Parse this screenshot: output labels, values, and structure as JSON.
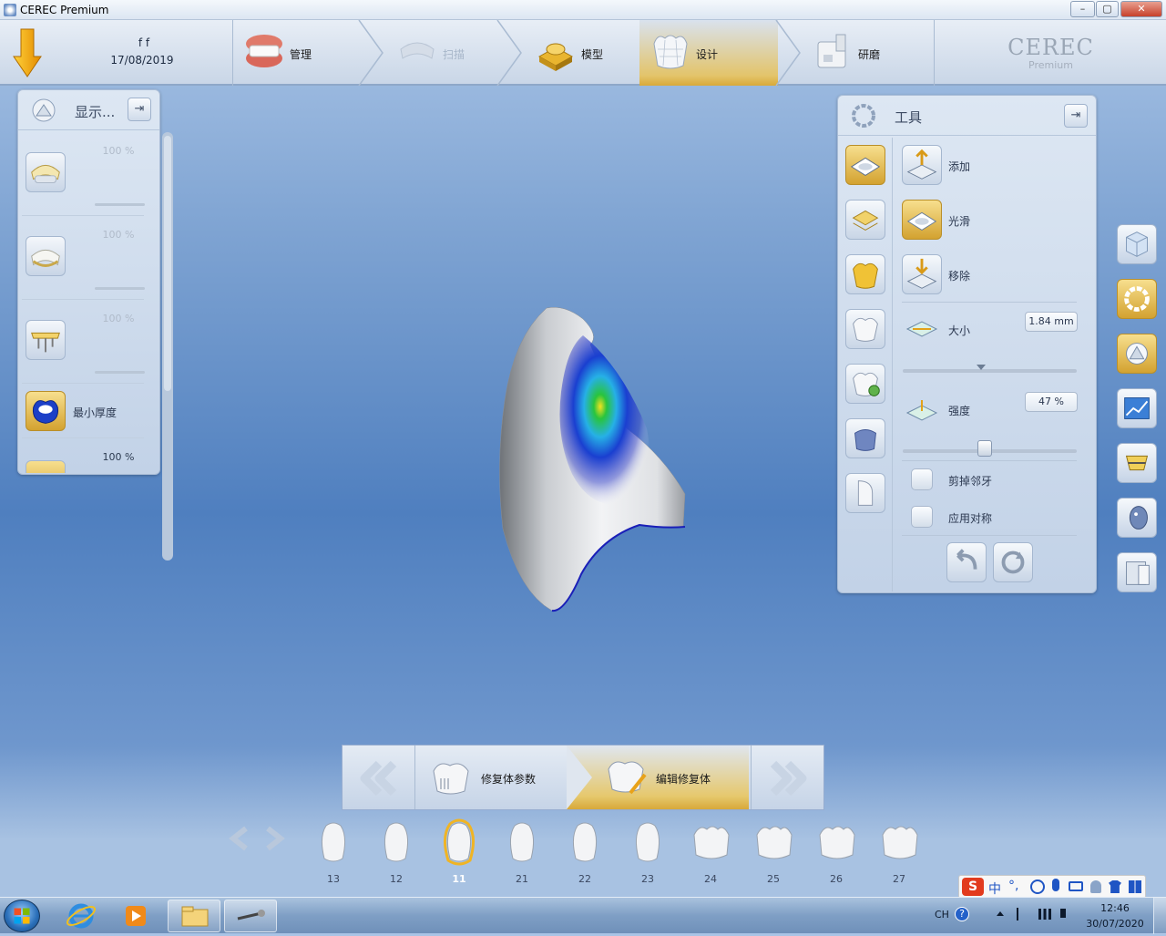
{
  "window": {
    "title": "CEREC Premium",
    "min": "–",
    "max": "▢",
    "close": "✕"
  },
  "patient": {
    "name": "f f",
    "date": "17/08/2019"
  },
  "workflow": {
    "steps": [
      {
        "label": "管理",
        "state": "normal"
      },
      {
        "label": "扫描",
        "state": "disabled"
      },
      {
        "label": "模型",
        "state": "normal"
      },
      {
        "label": "设计",
        "state": "active"
      },
      {
        "label": "研磨",
        "state": "normal"
      }
    ]
  },
  "brand": {
    "name": "CEREC",
    "edition": "Premium"
  },
  "left_panel": {
    "title": "显示...",
    "pin": "⇥",
    "rows": [
      {
        "percent": "100 %",
        "enabled": false
      },
      {
        "percent": "100 %",
        "enabled": false
      },
      {
        "percent": "100 %",
        "enabled": false
      },
      {
        "label": "最小厚度"
      },
      {
        "percent": "100 %",
        "enabled": true
      }
    ]
  },
  "tools_panel": {
    "title": "工具",
    "pin": "⇥",
    "tools": [
      {
        "label": "添加",
        "selected": false
      },
      {
        "label": "光滑",
        "selected": true
      },
      {
        "label": "移除",
        "selected": false
      }
    ],
    "size": {
      "label": "大小",
      "value": "1.84 mm",
      "level": 0.45
    },
    "strength": {
      "label": "强度",
      "value": "47 %",
      "level": 0.47
    },
    "options": [
      {
        "label": "剪掉邻牙",
        "checked": false
      },
      {
        "label": "应用对称",
        "checked": false
      }
    ]
  },
  "subflow": {
    "steps": [
      {
        "label": "修复体参数",
        "state": "normal"
      },
      {
        "label": "编辑修复体",
        "state": "active"
      }
    ]
  },
  "teeth": [
    {
      "number": "13",
      "selected": false
    },
    {
      "number": "12",
      "selected": false
    },
    {
      "number": "11",
      "selected": true
    },
    {
      "number": "21",
      "selected": false
    },
    {
      "number": "22",
      "selected": false
    },
    {
      "number": "23",
      "selected": false
    },
    {
      "number": "24",
      "selected": false
    },
    {
      "number": "25",
      "selected": false
    },
    {
      "number": "26",
      "selected": false
    },
    {
      "number": "27",
      "selected": false
    }
  ],
  "ime": {
    "logo": "S",
    "mode": "中",
    "punct": "°,"
  },
  "taskbar": {
    "lang": "CH",
    "time": "12:46",
    "date": "30/07/2020"
  },
  "colors": {
    "accent_gold": "#d9a93a",
    "panel_bg": "#c9d7ea",
    "heatmap_blue": "#1a2fd0"
  }
}
